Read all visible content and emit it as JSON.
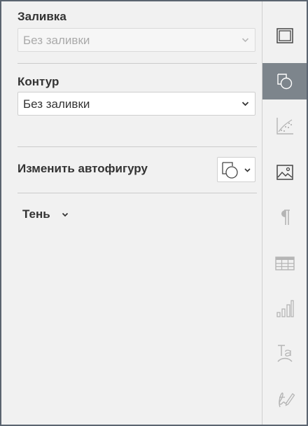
{
  "fill": {
    "title": "Заливка",
    "value": "Без заливки"
  },
  "stroke": {
    "title": "Контур",
    "value": "Без заливки"
  },
  "change_shape": {
    "label": "Изменить автофигуру"
  },
  "shadow": {
    "label": "Тень"
  },
  "sidebar": {
    "items": [
      {
        "icon": "slide-settings-icon",
        "active": false
      },
      {
        "icon": "shape-settings-icon",
        "active": true
      },
      {
        "icon": "chart-settings-icon",
        "active": false
      },
      {
        "icon": "image-settings-icon",
        "active": false
      },
      {
        "icon": "paragraph-settings-icon",
        "active": false
      },
      {
        "icon": "table-settings-icon",
        "active": false
      },
      {
        "icon": "chart-bars-icon",
        "active": false
      },
      {
        "icon": "text-art-icon",
        "active": false
      },
      {
        "icon": "signature-icon",
        "active": false
      }
    ]
  },
  "colors": {
    "panel_bg": "#f1f1f1",
    "active_tab": "#7d858c",
    "text": "#333333",
    "disabled_text": "#aaaaaa",
    "icon": "#444444",
    "icon_muted": "#b5b5b5"
  }
}
